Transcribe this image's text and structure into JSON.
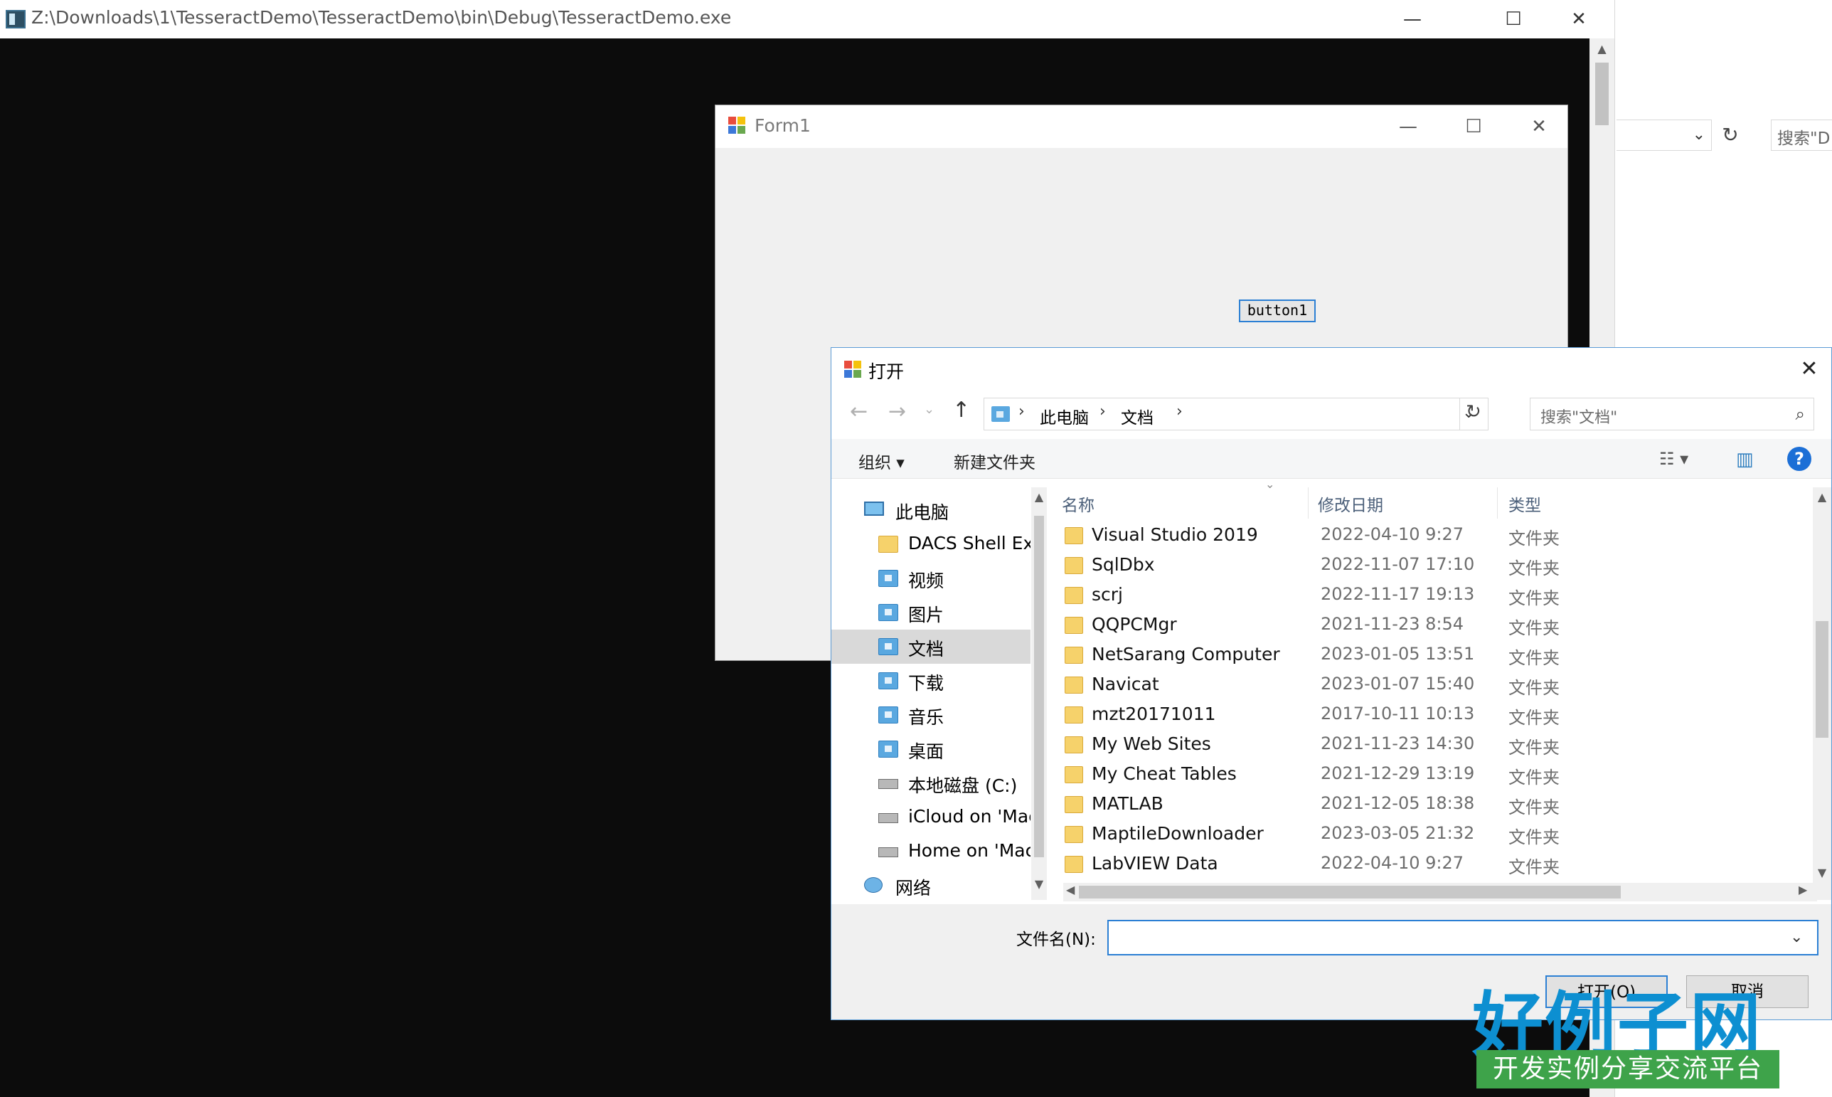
{
  "console": {
    "title": "Z:\\Downloads\\1\\TesseractDemo\\TesseractDemo\\bin\\Debug\\TesseractDemo.exe",
    "minimize": "—",
    "maximize": "☐",
    "close": "✕"
  },
  "background_window": {
    "search_placeholder": "搜索\"D"
  },
  "form1": {
    "title": "Form1",
    "button_label": "button1",
    "minimize": "—",
    "maximize": "☐",
    "close": "✕"
  },
  "dialog": {
    "title": "打开",
    "close": "✕",
    "breadcrumb": [
      "此电脑",
      "文档"
    ],
    "search_placeholder": "搜索\"文档\"",
    "toolbar": {
      "organize": "组织 ▾",
      "new_folder": "新建文件夹"
    },
    "nav_items": [
      {
        "label": "此电脑",
        "icon": "computer-icon"
      },
      {
        "label": "DACS Shell Exte",
        "icon": "folder-icon"
      },
      {
        "label": "视频",
        "icon": "videos-folder-icon"
      },
      {
        "label": "图片",
        "icon": "pictures-folder-icon"
      },
      {
        "label": "文档",
        "icon": "documents-folder-icon",
        "selected": true
      },
      {
        "label": "下载",
        "icon": "downloads-folder-icon"
      },
      {
        "label": "音乐",
        "icon": "music-folder-icon"
      },
      {
        "label": "桌面",
        "icon": "desktop-folder-icon"
      },
      {
        "label": "本地磁盘 (C:)",
        "icon": "drive-icon"
      },
      {
        "label": "iCloud on 'Mac",
        "icon": "network-drive-icon"
      },
      {
        "label": "Home on 'Mac",
        "icon": "network-drive-icon"
      },
      {
        "label": "网络",
        "icon": "network-icon"
      }
    ],
    "columns": {
      "name": "名称",
      "date": "修改日期",
      "type": "类型"
    },
    "files": [
      {
        "name": "Visual Studio 2019",
        "date": "2022-04-10 9:27",
        "type": "文件夹"
      },
      {
        "name": "SqlDbx",
        "date": "2022-11-07 17:10",
        "type": "文件夹"
      },
      {
        "name": "scrj",
        "date": "2022-11-17 19:13",
        "type": "文件夹"
      },
      {
        "name": "QQPCMgr",
        "date": "2021-11-23 8:54",
        "type": "文件夹"
      },
      {
        "name": "NetSarang Computer",
        "date": "2023-01-05 13:51",
        "type": "文件夹"
      },
      {
        "name": "Navicat",
        "date": "2023-01-07 15:40",
        "type": "文件夹"
      },
      {
        "name": "mzt20171011",
        "date": "2017-10-11 10:13",
        "type": "文件夹"
      },
      {
        "name": "My Web Sites",
        "date": "2021-11-23 14:30",
        "type": "文件夹"
      },
      {
        "name": "My Cheat Tables",
        "date": "2021-12-29 13:19",
        "type": "文件夹"
      },
      {
        "name": "MATLAB",
        "date": "2021-12-05 18:38",
        "type": "文件夹"
      },
      {
        "name": "MaptileDownloader",
        "date": "2023-03-05 21:32",
        "type": "文件夹"
      },
      {
        "name": "LabVIEW Data",
        "date": "2022-04-10 9:27",
        "type": "文件夹"
      }
    ],
    "filename_label": "文件名(N):",
    "filename_value": "",
    "open_button": "打开(O)",
    "cancel_button": "取消"
  },
  "watermark": {
    "logo_main": "好例子网",
    "logo_sub": "开发实例分享交流平台"
  },
  "colors": {
    "console_bg": "#0c0c0c",
    "accent": "#2b7fd4",
    "selected_nav": "#d9d9d9",
    "logo_blue": "#0d8fd1",
    "logo_green": "#3ea34a"
  }
}
